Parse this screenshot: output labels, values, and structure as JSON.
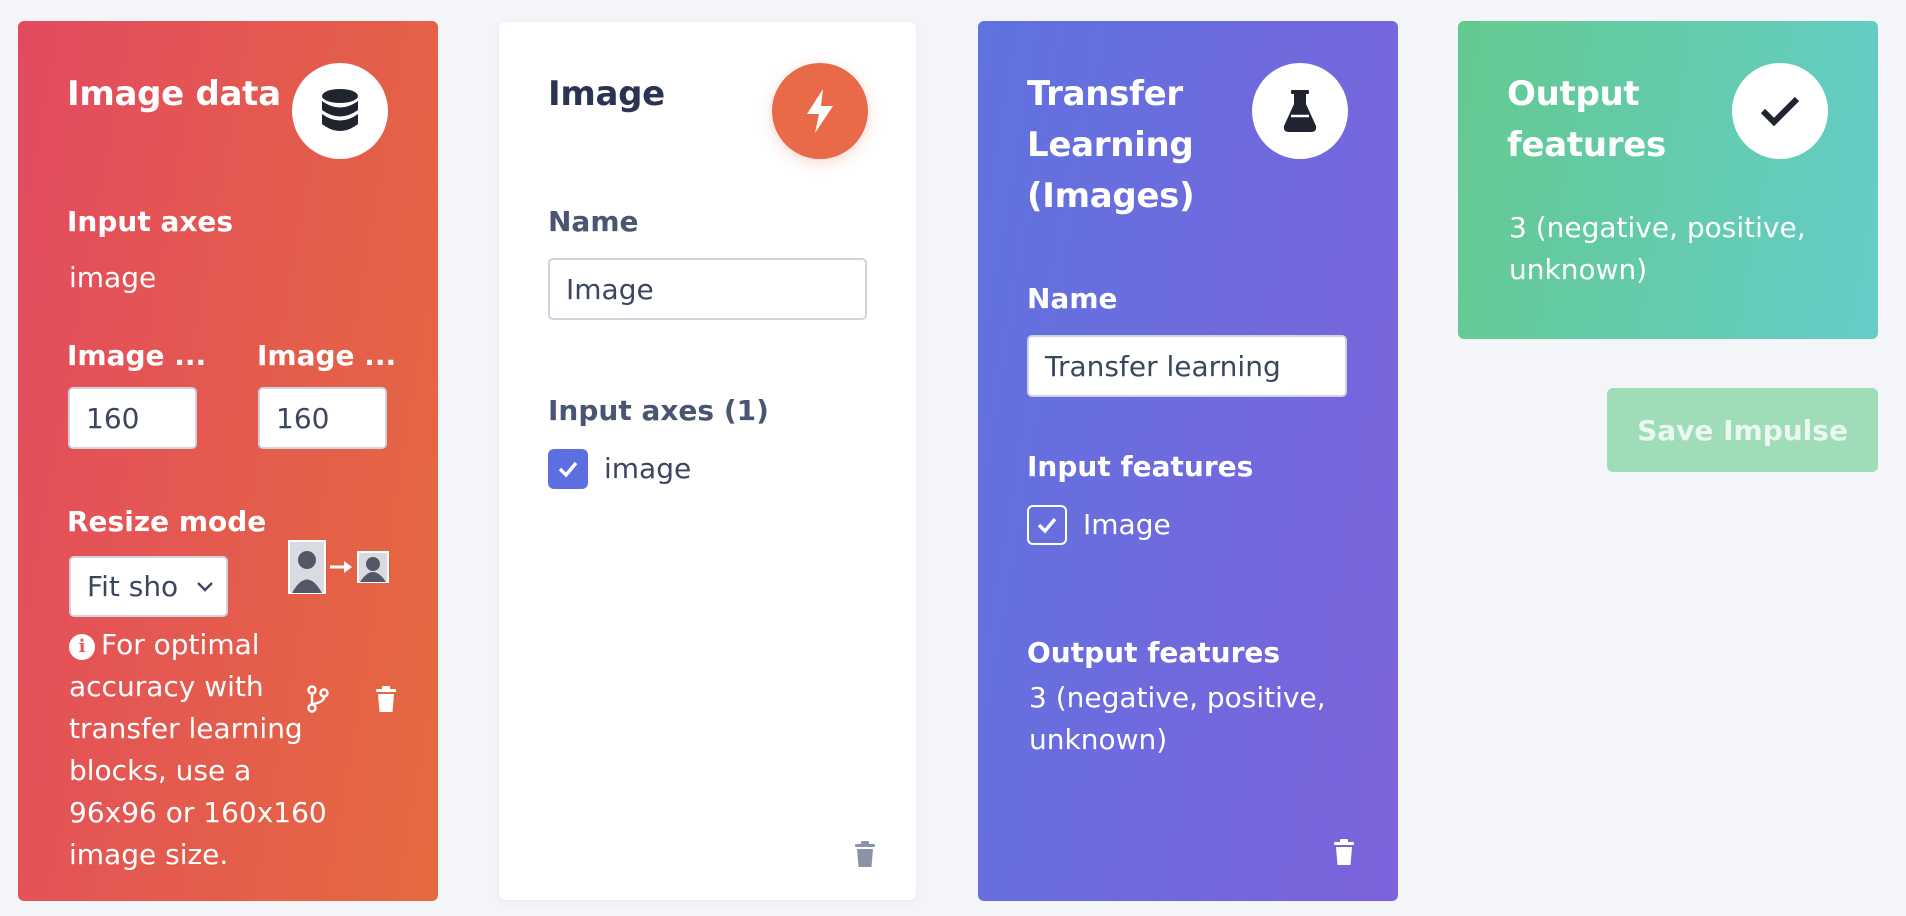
{
  "input_block": {
    "title": "Image data",
    "icon": "database-icon",
    "input_axes_label": "Input axes",
    "input_axes_value": "image",
    "width_label": "Image ...",
    "height_label": "Image ...",
    "width_value": "160",
    "height_value": "160",
    "resize_mode_label": "Resize mode",
    "resize_mode_value": "Fit sho",
    "info_text": "For optimal accuracy with transfer learning blocks, use a 96x96 or 160x160 image size."
  },
  "processing_block": {
    "title": "Image",
    "icon": "bolt-icon",
    "name_label": "Name",
    "name_value": "Image",
    "input_axes_label": "Input axes (1)",
    "axes": [
      {
        "label": "image",
        "checked": true
      }
    ]
  },
  "learning_block": {
    "title": "Transfer Learning (Images)",
    "icon": "flask-icon",
    "name_label": "Name",
    "name_value": "Transfer learning",
    "input_features_label": "Input features",
    "input_features": [
      {
        "label": "Image",
        "checked": true
      }
    ],
    "output_features_label": "Output features",
    "output_features_value": "3 (negative, positive, unknown)"
  },
  "output_block": {
    "title": "Output features",
    "icon": "check-icon",
    "value": "3 (negative, positive, unknown)"
  },
  "save_button_label": "Save Impulse",
  "colors": {
    "input_gradient": [
      "#e34a60",
      "#e56a3e"
    ],
    "processing_accent": "#e86a48",
    "learning_gradient": [
      "#5f73df",
      "#7d62dc"
    ],
    "output_gradient": [
      "#64c98f",
      "#64cdc8"
    ],
    "save_button": "#9fdcb8",
    "checkbox_accent": "#5d6fe0"
  }
}
